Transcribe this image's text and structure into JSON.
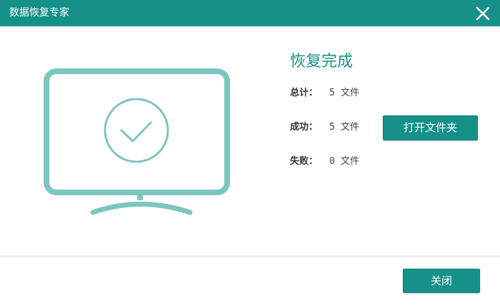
{
  "window": {
    "title": "数据恢复专家"
  },
  "result": {
    "heading": "恢复完成",
    "total_label": "总计：",
    "total_count": "5",
    "total_unit": "文件",
    "success_label": "成功：",
    "success_count": "5",
    "success_unit": "文件",
    "failed_label": "失败：",
    "failed_count": "0",
    "failed_unit": "文件"
  },
  "actions": {
    "open_folder_label": "打开文件夹",
    "close_label": "关闭"
  },
  "icons": {
    "illustration": "monitor-check-icon",
    "close": "close-icon"
  },
  "colors": {
    "accent": "#15918a",
    "illustration": "#7cc6c0",
    "background": "#ffffff"
  }
}
